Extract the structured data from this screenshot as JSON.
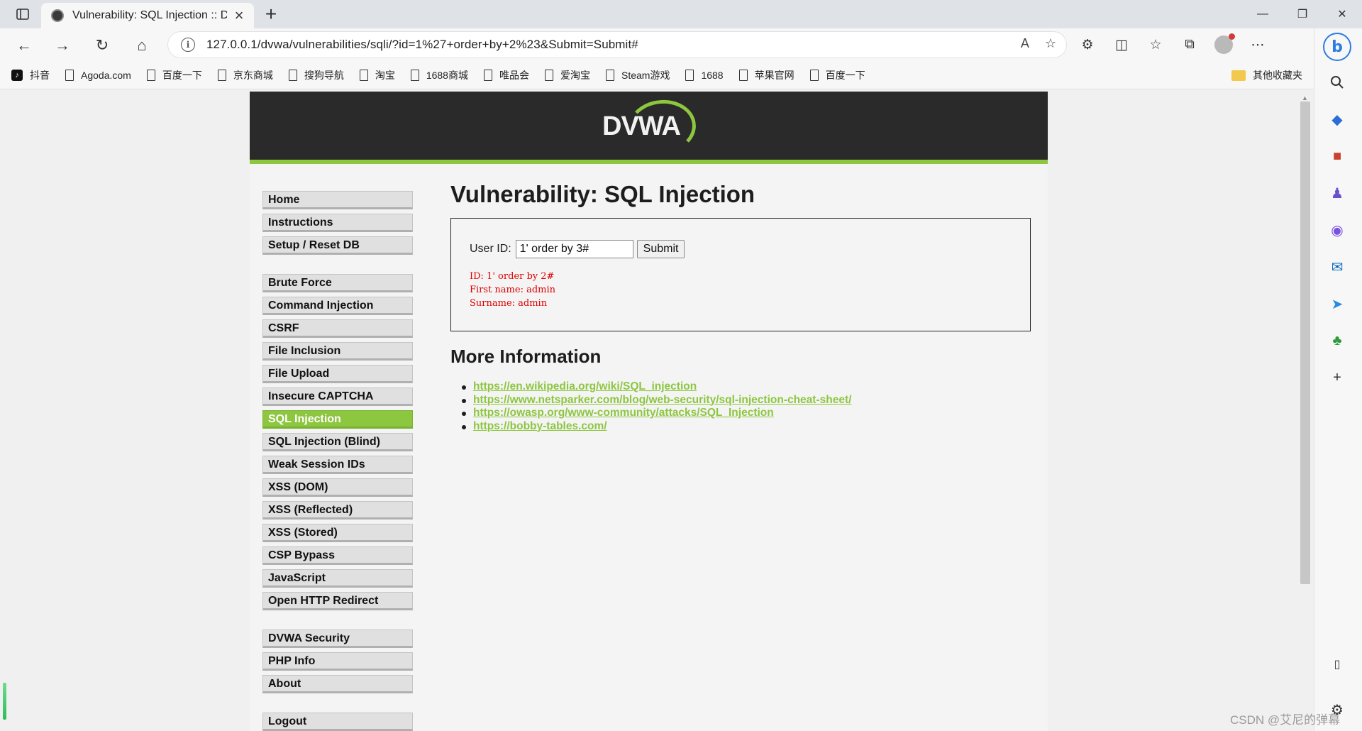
{
  "browser": {
    "tab_title": "Vulnerability: SQL Injection :: Dan",
    "url": "127.0.0.1/dvwa/vulnerabilities/sqli/?id=1%27+order+by+2%23&Submit=Submit#",
    "bookmarks": [
      "抖音",
      "Agoda.com",
      "百度一下",
      "京东商城",
      "搜狗导航",
      "淘宝",
      "1688商城",
      "唯品会",
      "爱淘宝",
      "Steam游戏",
      "1688",
      "苹果官网",
      "百度一下"
    ],
    "other_bookmarks": "其他收藏夹"
  },
  "dvwa": {
    "logo": "DVWA",
    "menu_group_1": [
      "Home",
      "Instructions",
      "Setup / Reset DB"
    ],
    "menu_group_2": [
      "Brute Force",
      "Command Injection",
      "CSRF",
      "File Inclusion",
      "File Upload",
      "Insecure CAPTCHA",
      "SQL Injection",
      "SQL Injection (Blind)",
      "Weak Session IDs",
      "XSS (DOM)",
      "XSS (Reflected)",
      "XSS (Stored)",
      "CSP Bypass",
      "JavaScript",
      "Open HTTP Redirect"
    ],
    "menu_group_3": [
      "DVWA Security",
      "PHP Info",
      "About"
    ],
    "menu_group_4": [
      "Logout"
    ],
    "active_item": "SQL Injection",
    "accent_color": "#8dc63f",
    "page_title": "Vulnerability: SQL Injection",
    "form": {
      "label": "User ID:",
      "input_value": "1' order by 3#",
      "submit_label": "Submit"
    },
    "result": {
      "id_line": "ID: 1' order by 2#",
      "first_name_line": "First name: admin",
      "surname_line": "Surname: admin"
    },
    "more_info_title": "More Information",
    "links": [
      "https://en.wikipedia.org/wiki/SQL_injection",
      "https://www.netsparker.com/blog/web-security/sql-injection-cheat-sheet/",
      "https://owasp.org/www-community/attacks/SQL_Injection",
      "https://bobby-tables.com/"
    ]
  },
  "watermark": "CSDN @艾尼的弹幕"
}
